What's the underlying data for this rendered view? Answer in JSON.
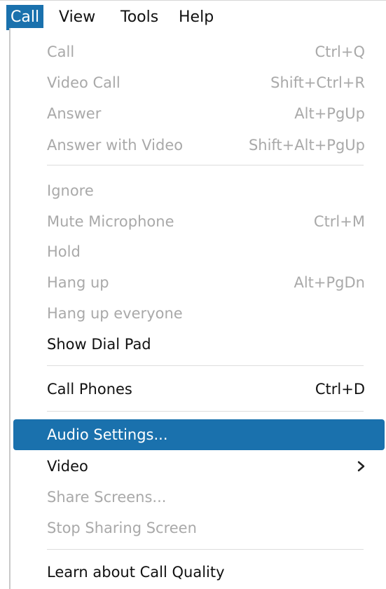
{
  "menubar": {
    "items": [
      "Call",
      "View",
      "Tools",
      "Help"
    ]
  },
  "menu": {
    "items": [
      {
        "label": "Call",
        "shortcut": "Ctrl+Q"
      },
      {
        "label": "Video Call",
        "shortcut": "Shift+Ctrl+R"
      },
      {
        "label": "Answer",
        "shortcut": "Alt+PgUp"
      },
      {
        "label": "Answer with Video",
        "shortcut": "Shift+Alt+PgUp"
      },
      {
        "label": "Ignore"
      },
      {
        "label": "Mute Microphone",
        "shortcut": "Ctrl+M"
      },
      {
        "label": "Hold"
      },
      {
        "label": "Hang up",
        "shortcut": "Alt+PgDn"
      },
      {
        "label": "Hang up everyone"
      },
      {
        "label": "Show Dial Pad"
      },
      {
        "label": "Call Phones",
        "shortcut": "Ctrl+D"
      },
      {
        "label": "Audio Settings..."
      },
      {
        "label": "Video",
        "submenu_icon": "chevron-right-icon"
      },
      {
        "label": "Share Screens..."
      },
      {
        "label": "Stop Sharing Screen"
      },
      {
        "label": "Learn about Call Quality"
      }
    ]
  },
  "colors": {
    "accent": "#1a71ad",
    "disabled_text": "#a9a9a9",
    "enabled_text": "#111111"
  }
}
